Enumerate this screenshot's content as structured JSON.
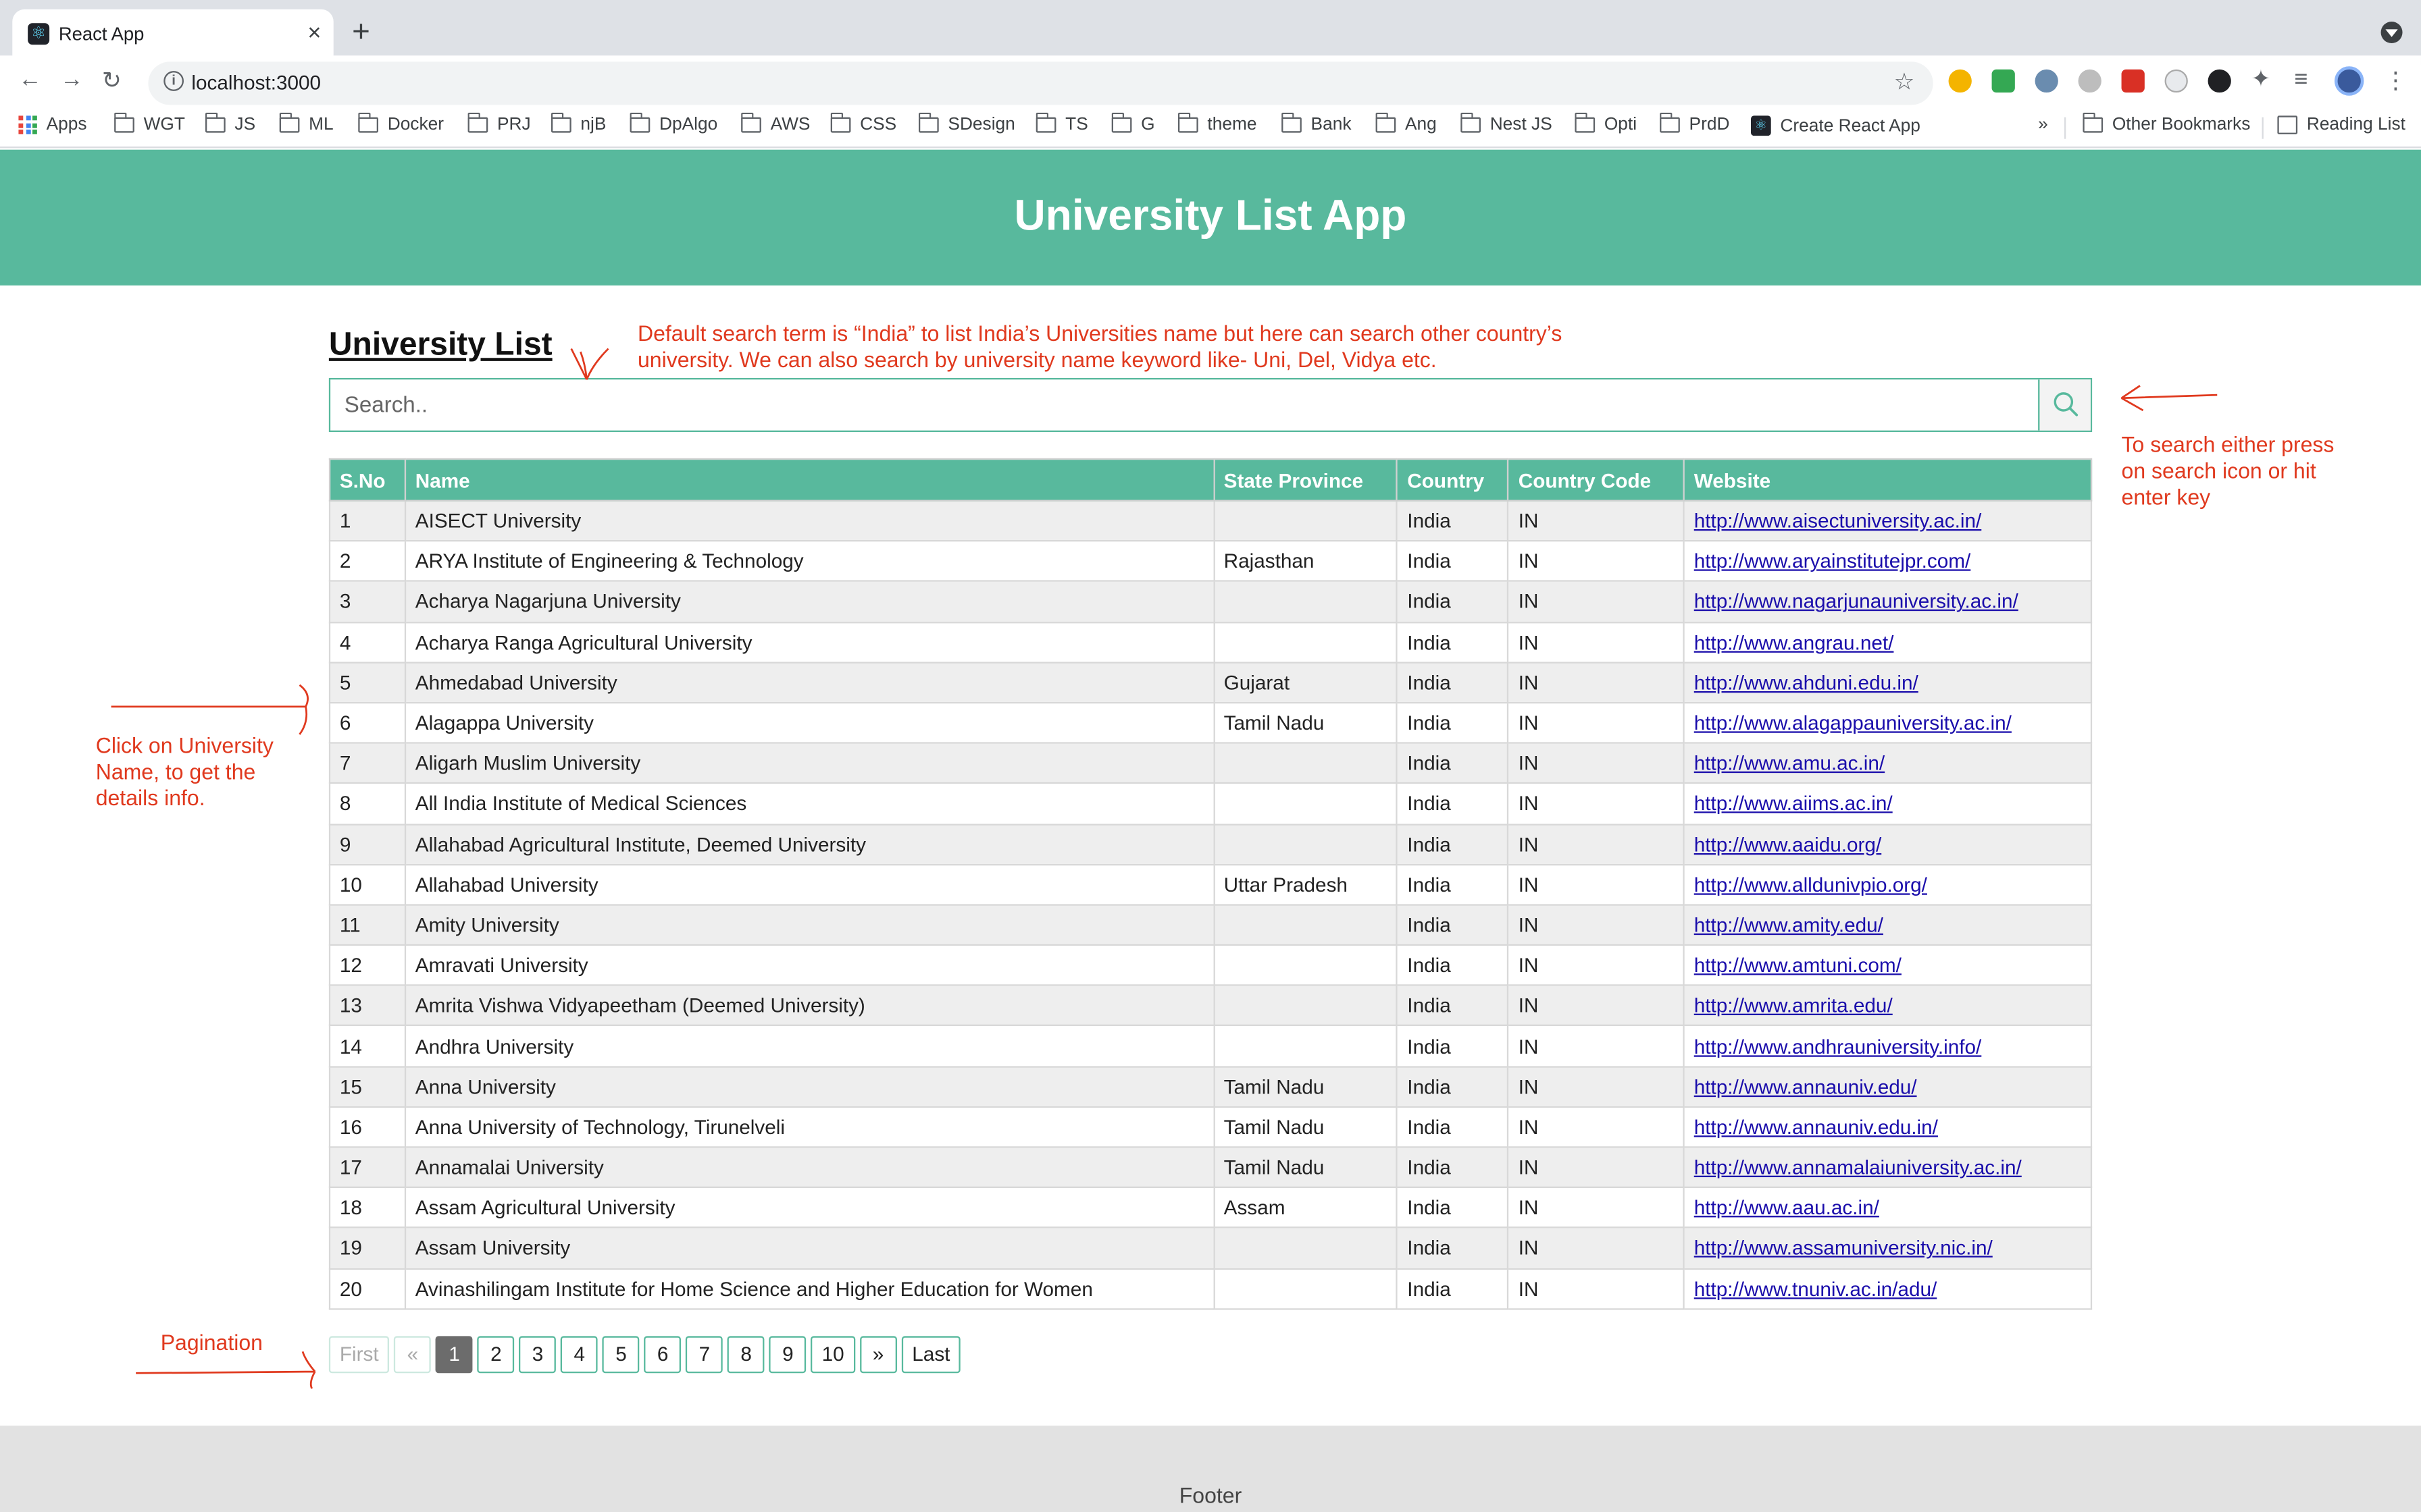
{
  "browser": {
    "tab_title": "React App",
    "tab_close": "×",
    "new_tab": "+",
    "url": "localhost:3000",
    "bookmarks": [
      "Apps",
      "WGT",
      "JS",
      "ML",
      "Docker",
      "PRJ",
      "njB",
      "DpAlgo",
      "AWS",
      "CSS",
      "SDesign",
      "TS",
      "G",
      "theme",
      "Bank",
      "Ang",
      "Nest JS",
      "Opti",
      "PrdD",
      "Create React App"
    ],
    "bookmarks_overflow": "»",
    "other_bookmarks": "Other Bookmarks",
    "reading_list": "Reading List"
  },
  "app": {
    "title": "University List App",
    "list_heading": "University List",
    "search_placeholder": "Search..",
    "accent_color": "#58b99d",
    "footer": "Footer"
  },
  "table": {
    "headers": [
      "S.No",
      "Name",
      "State Province",
      "Country",
      "Country Code",
      "Website"
    ],
    "rows": [
      [
        "1",
        "AISECT University",
        "",
        "India",
        "IN",
        "http://www.aisectuniversity.ac.in/"
      ],
      [
        "2",
        "ARYA Institute of Engineering & Technology",
        "Rajasthan",
        "India",
        "IN",
        "http://www.aryainstitutejpr.com/"
      ],
      [
        "3",
        "Acharya Nagarjuna University",
        "",
        "India",
        "IN",
        "http://www.nagarjunauniversity.ac.in/"
      ],
      [
        "4",
        "Acharya Ranga Agricultural University",
        "",
        "India",
        "IN",
        "http://www.angrau.net/"
      ],
      [
        "5",
        "Ahmedabad University",
        "Gujarat",
        "India",
        "IN",
        "http://www.ahduni.edu.in/"
      ],
      [
        "6",
        "Alagappa University",
        "Tamil Nadu",
        "India",
        "IN",
        "http://www.alagappauniversity.ac.in/"
      ],
      [
        "7",
        "Aligarh Muslim University",
        "",
        "India",
        "IN",
        "http://www.amu.ac.in/"
      ],
      [
        "8",
        "All India Institute of Medical Sciences",
        "",
        "India",
        "IN",
        "http://www.aiims.ac.in/"
      ],
      [
        "9",
        "Allahabad Agricultural Institute, Deemed University",
        "",
        "India",
        "IN",
        "http://www.aaidu.org/"
      ],
      [
        "10",
        "Allahabad University",
        "Uttar Pradesh",
        "India",
        "IN",
        "http://www.alldunivpio.org/"
      ],
      [
        "11",
        "Amity University",
        "",
        "India",
        "IN",
        "http://www.amity.edu/"
      ],
      [
        "12",
        "Amravati University",
        "",
        "India",
        "IN",
        "http://www.amtuni.com/"
      ],
      [
        "13",
        "Amrita Vishwa Vidyapeetham (Deemed University)",
        "",
        "India",
        "IN",
        "http://www.amrita.edu/"
      ],
      [
        "14",
        "Andhra University",
        "",
        "India",
        "IN",
        "http://www.andhrauniversity.info/"
      ],
      [
        "15",
        "Anna University",
        "Tamil Nadu",
        "India",
        "IN",
        "http://www.annauniv.edu/"
      ],
      [
        "16",
        "Anna University of Technology, Tirunelveli",
        "Tamil Nadu",
        "India",
        "IN",
        "http://www.annauniv.edu.in/"
      ],
      [
        "17",
        "Annamalai University",
        "Tamil Nadu",
        "India",
        "IN",
        "http://www.annamalaiuniversity.ac.in/"
      ],
      [
        "18",
        "Assam Agricultural University",
        "Assam",
        "India",
        "IN",
        "http://www.aau.ac.in/"
      ],
      [
        "19",
        "Assam University",
        "",
        "India",
        "IN",
        "http://www.assamuniversity.nic.in/"
      ],
      [
        "20",
        "Avinashilingam Institute for Home Science and Higher Education for Women",
        "",
        "India",
        "IN",
        "http://www.tnuniv.ac.in/adu/"
      ]
    ]
  },
  "pagination": {
    "first": "First",
    "prev": "«",
    "pages": [
      "1",
      "2",
      "3",
      "4",
      "5",
      "6",
      "7",
      "8",
      "9",
      "10"
    ],
    "active_page": "1",
    "next": "»",
    "last": "Last"
  },
  "annotations": {
    "search_term_note_line1": "Default search term is “India” to list India’s Universities name but here can search other country’s",
    "search_term_note_line2": "university. We can also search by university name keyword like- Uni, Del, Vidya etc.",
    "search_action_note_line1": "To search either press",
    "search_action_note_line2": "on search icon or hit",
    "search_action_note_line3": "enter key",
    "click_note_line1": "Click on University",
    "click_note_line2": "Name, to get the",
    "click_note_line3": "details info.",
    "pagination_note": "Pagination",
    "annotation_color": "#e0391e"
  }
}
